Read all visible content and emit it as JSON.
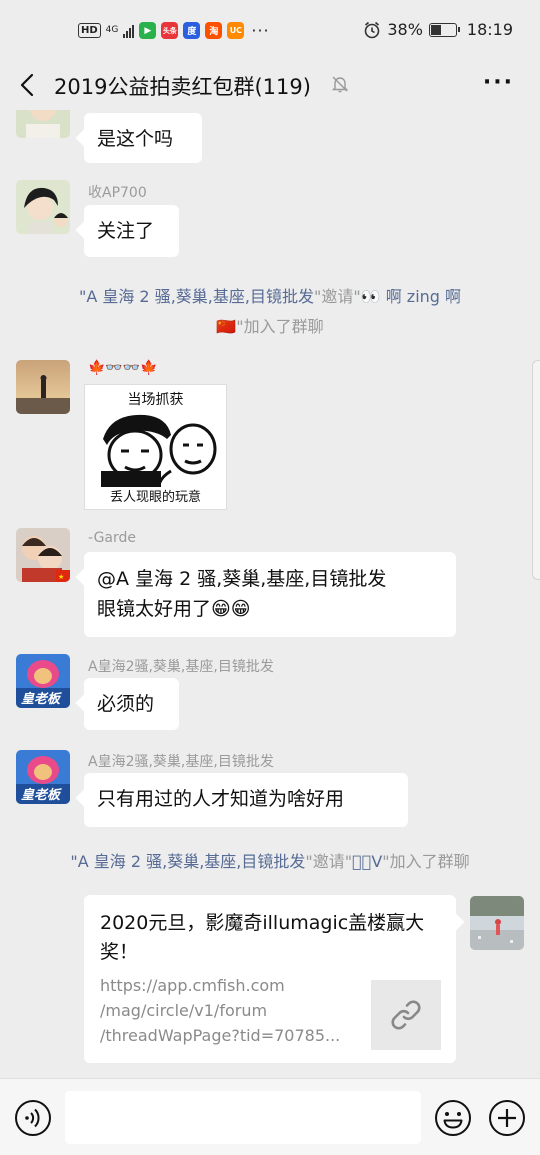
{
  "status_bar": {
    "hd": "HD",
    "network": "4G",
    "app_icons": [
      {
        "name": "video-app-icon",
        "label": "▶",
        "color": "#2ab14b"
      },
      {
        "name": "toutiao-app-icon",
        "label": "头条",
        "color": "#e8353a"
      },
      {
        "name": "baidu-app-icon",
        "label": "度",
        "color": "#2b5fe0"
      },
      {
        "name": "taobao-app-icon",
        "label": "淘",
        "color": "#ff5000"
      },
      {
        "name": "uc-app-icon",
        "label": "UC",
        "color": "#ff8a00"
      }
    ],
    "more": "···",
    "battery": "38%",
    "time": "18:19"
  },
  "nav": {
    "title": "2019公益拍卖红包群(119)",
    "more": "···"
  },
  "messages": {
    "m1": {
      "text": "是这个吗"
    },
    "m2": {
      "sender": "收AP700",
      "text": "关注了"
    },
    "sys1": {
      "name": "\"A 皇海 2 骚,葵巢,基座,目镜批发",
      "verb": "\"邀请\"",
      "invitee": "👀 啊 zing 啊",
      "invitee2": "🇨🇳",
      "tail": "\"加入了群聊"
    },
    "m3": {
      "sender": "🍁👓👓🍁",
      "meme_top": "当场抓获",
      "meme_bottom": "丢人现眼的玩意"
    },
    "m4": {
      "sender": "-Garde",
      "text_line1": "@A 皇海 2 骚,葵巢,基座,目镜批发",
      "text_line2": "眼镜太好用了😁😁"
    },
    "m5": {
      "sender": "A皇海2骚,葵巢,基座,目镜批发",
      "text": "必须的"
    },
    "m6": {
      "sender": "A皇海2骚,葵巢,基座,目镜批发",
      "text": "只有用过的人才知道为啥好用"
    },
    "sys2": {
      "name": "\"A 皇海 2 骚,葵巢,基座,目镜批发",
      "verb": "\"邀请\"",
      "invitee": "\u0000\u0000V",
      "tail": "\"加入了群聊"
    },
    "link": {
      "title": "2020元旦，影魔奇illumagic盖楼赢大奖！",
      "url_line1": "https://app.cmfish.com",
      "url_line2": "/mag/circle/v1/forum",
      "url_line3": "/threadWapPage?tid=70785..."
    }
  },
  "input": {
    "placeholder": ""
  }
}
